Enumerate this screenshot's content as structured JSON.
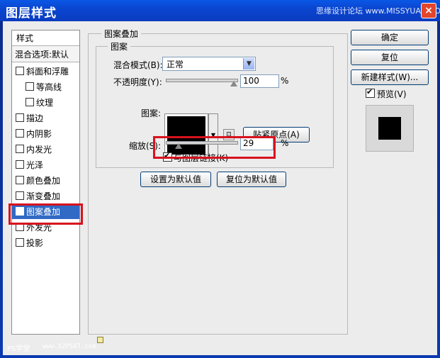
{
  "window": {
    "title": "图层样式",
    "watermark": "思缘设计论坛 www.MISSYUAN.COM",
    "close_label": "×"
  },
  "sidebar": {
    "header": "样式",
    "blend_options": "混合选项:默认",
    "items": [
      {
        "label": "斜面和浮雕",
        "checked": false
      },
      {
        "label": "等高线",
        "checked": false
      },
      {
        "label": "纹理",
        "checked": false
      },
      {
        "label": "描边",
        "checked": false
      },
      {
        "label": "内阴影",
        "checked": false
      },
      {
        "label": "内发光",
        "checked": false
      },
      {
        "label": "光泽",
        "checked": false
      },
      {
        "label": "颜色叠加",
        "checked": false
      },
      {
        "label": "渐变叠加",
        "checked": false
      },
      {
        "label": "图案叠加",
        "checked": true
      },
      {
        "label": "外发光",
        "checked": false
      },
      {
        "label": "投影",
        "checked": false
      }
    ]
  },
  "panel": {
    "group_title": "图案叠加",
    "subgroup_title": "图案",
    "blend_mode_label": "混合模式(B):",
    "blend_mode_value": "正常",
    "opacity_label": "不透明度(Y):",
    "opacity_value": "100",
    "opacity_unit": "%",
    "opacity_fraction": 1.0,
    "pattern_label": "图案:",
    "snap_button": "贴紧原点(A)",
    "scale_label": "缩放(S):",
    "scale_value": "29",
    "scale_unit": "%",
    "scale_fraction": 0.29,
    "link_label": "与图层链接(K)",
    "link_checked": true,
    "set_default_button": "设置为默认值",
    "reset_default_button": "复位为默认值"
  },
  "right": {
    "ok_button": "确定",
    "reset_button": "复位",
    "new_style_button": "新建样式(W)...",
    "preview_label": "预览(V)",
    "preview_checked": true
  },
  "footer": {
    "logo_text": "PS学堂",
    "site": "www.52PSXT.com"
  },
  "colors": {
    "selection": "#316ac5",
    "highlight": "#d8121e",
    "titlebar": "#0a46d0"
  }
}
